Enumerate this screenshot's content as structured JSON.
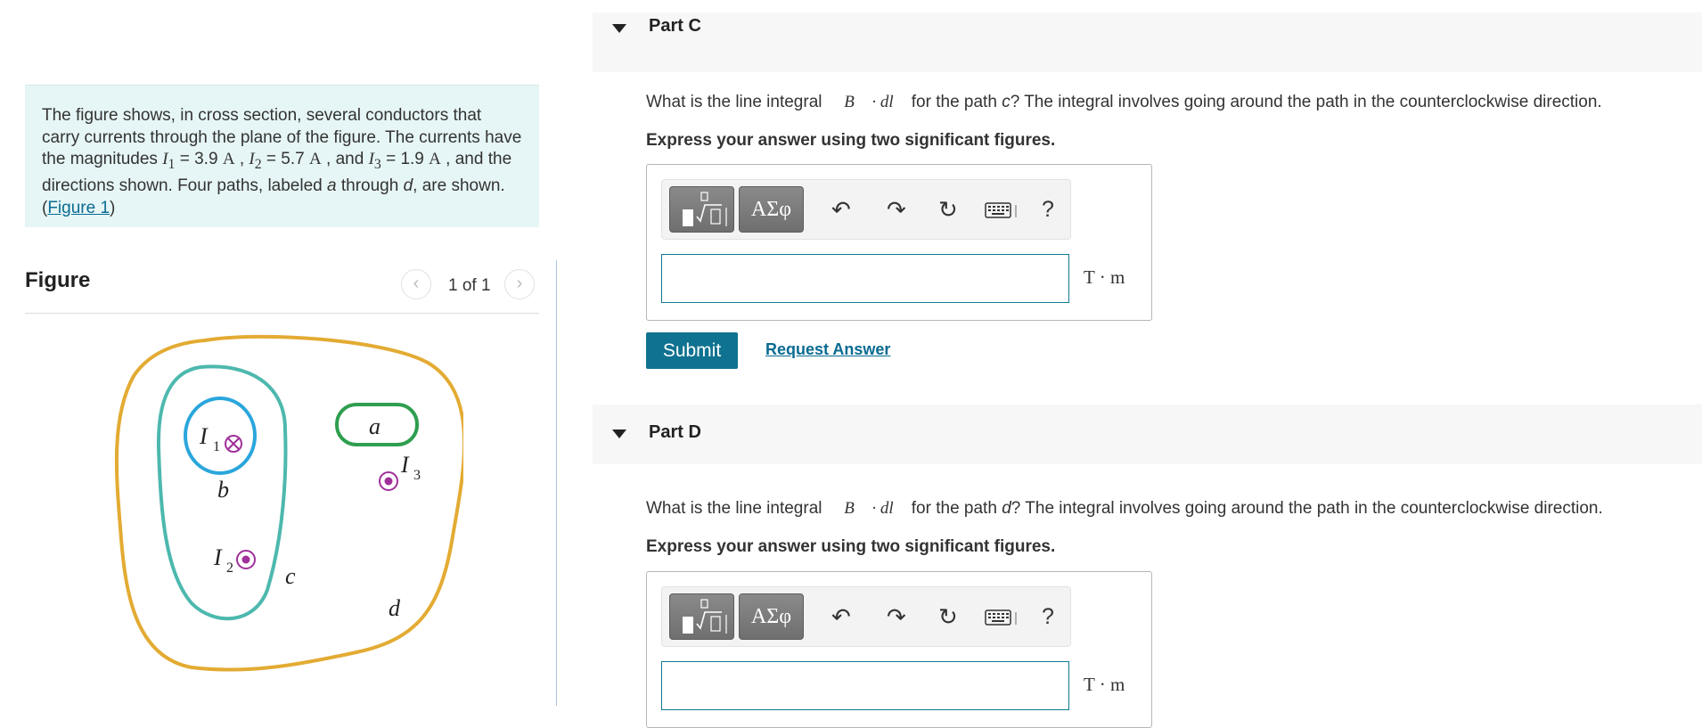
{
  "problem": {
    "text_1": "The figure shows, in cross section, several conductors that carry currents through the plane of the figure. The currents have the magnitudes ",
    "i1_symbol": "I",
    "i1_sub": "1",
    "i1_value": " = 3.9 ",
    "i1_unit": "A",
    "sep_1": " , ",
    "i2_symbol": "I",
    "i2_sub": "2",
    "i2_value": " = 5.7 ",
    "i2_unit": "A",
    "sep_2": " , and ",
    "i3_symbol": "I",
    "i3_sub": "3",
    "i3_value": " = 1.9 ",
    "i3_unit": "A",
    "text_2": " , and the directions shown. Four paths, labeled ",
    "path_a": "a",
    "text_3": " through ",
    "path_d": "d",
    "text_4": ", are shown. (",
    "figure_link": "Figure 1",
    "text_5": ")"
  },
  "figure": {
    "title": "Figure",
    "pager_text": "1 of 1",
    "prev_icon": "chevron-left-icon",
    "next_icon": "chevron-right-icon",
    "labels": {
      "a": "a",
      "b": "b",
      "c": "c",
      "d": "d",
      "I1": "I",
      "I1_sub": "1",
      "I2": "I",
      "I2_sub": "2",
      "I3": "I",
      "I3_sub": "3"
    },
    "colors": {
      "path_a": "#2e9e4f",
      "path_b": "#2aa6dc",
      "path_c": "#4db8ae",
      "path_d": "#e3ab33",
      "conductor_in": "#a0309a",
      "conductor_out": "#a0309a"
    }
  },
  "parts": [
    {
      "title": "Part C",
      "question_pre": "What is the line integral ",
      "integral": "∮ B⃗ · dl⃗",
      "question_mid": " for the path ",
      "path": "c",
      "question_post": "? The integral involves going around the path in the counterclockwise direction.",
      "instruction": "Express your answer using two significant figures.",
      "input_value": "",
      "unit": "T · m"
    },
    {
      "title": "Part D",
      "question_pre": "What is the line integral ",
      "integral": "∮ B⃗ · dl⃗",
      "question_mid": " for the path ",
      "path": "d",
      "question_post": "? The integral involves going around the path in the counterclockwise direction.",
      "instruction": "Express your answer using two significant figures.",
      "input_value": "",
      "unit": "T · m"
    }
  ],
  "toolbar": {
    "symbols_label": "ΑΣφ",
    "undo_icon": "undo-icon",
    "redo_icon": "redo-icon",
    "reset_icon": "reset-icon",
    "keyboard_icon": "keyboard-icon",
    "help_label": "?"
  },
  "actions": {
    "submit_label": "Submit",
    "request_answer_label": "Request Answer"
  },
  "colors": {
    "accent": "#0f7290",
    "link": "#0a6b92",
    "problem_bg": "#e6f5f5"
  }
}
